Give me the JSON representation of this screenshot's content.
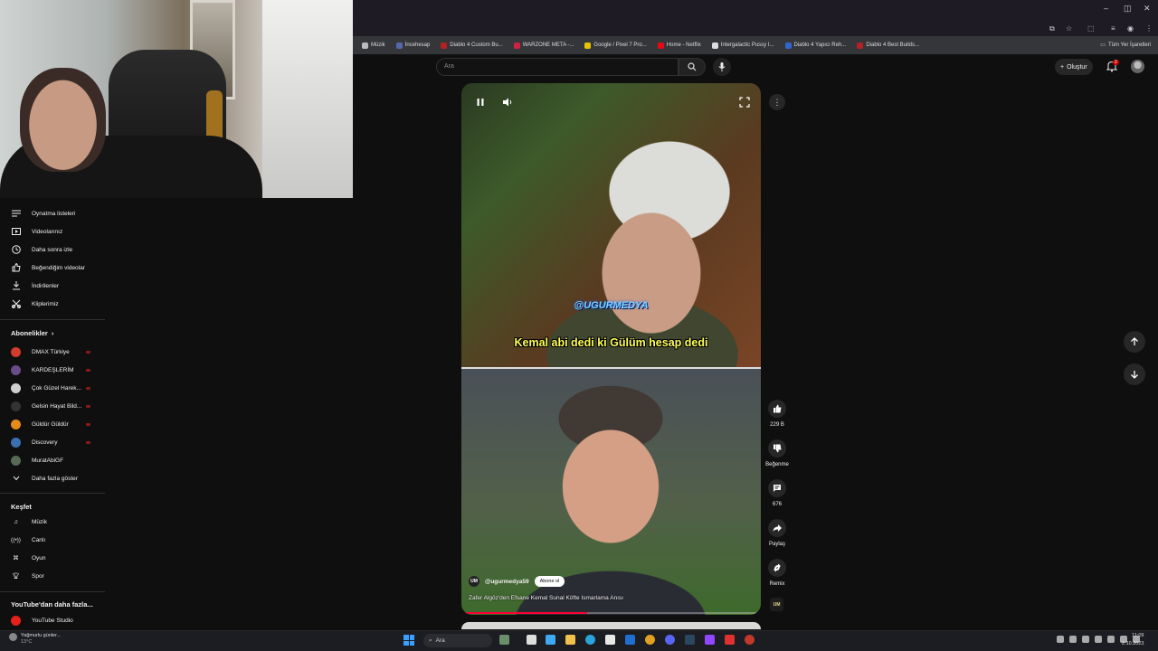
{
  "browser": {
    "bookmarks": [
      {
        "label": "Müzik",
        "color": "#bbbbbb"
      },
      {
        "label": "İncehesap",
        "color": "#5566aa"
      },
      {
        "label": "Diablo 4 Custom Bu...",
        "color": "#b22222"
      },
      {
        "label": "WARZONE META -...",
        "color": "#cc2244"
      },
      {
        "label": "Google / Pixel 7 Pro...",
        "color": "#e6c200"
      },
      {
        "label": "Home - Netflix",
        "color": "#e50914"
      },
      {
        "label": "Intergalactic Pussy I...",
        "color": "#dddddd"
      },
      {
        "label": "Diablo 4 Yapıcı Reh...",
        "color": "#3366cc"
      },
      {
        "label": "Diablo 4 Best Builds...",
        "color": "#b22222"
      }
    ],
    "other_bookmarks": "Tüm Yer İşaretleri"
  },
  "youtube": {
    "search_placeholder": "Ara",
    "create_label": "Oluştur",
    "notification_count": "2"
  },
  "sidebar": {
    "library_items": [
      {
        "label": "Oynatma listeleri",
        "icon": "playlist-icon"
      },
      {
        "label": "Videolarınız",
        "icon": "your-videos-icon"
      },
      {
        "label": "Daha sonra izle",
        "icon": "watch-later-icon"
      },
      {
        "label": "Beğendiğim videolar",
        "icon": "like-icon"
      },
      {
        "label": "İndirilenler",
        "icon": "download-icon"
      },
      {
        "label": "Kliplerimiz",
        "icon": "clips-icon"
      }
    ],
    "subscriptions_header": "Abonelikler",
    "subscriptions": [
      {
        "label": "DMAX Türkiye",
        "color": "#d33b2c",
        "live": true
      },
      {
        "label": "KARDEŞLERİM",
        "color": "#6a4c8a",
        "live": true
      },
      {
        "label": "Çok Güzel Harek...",
        "color": "#d0d0d0",
        "live": true
      },
      {
        "label": "Gelsin Hayat Bild...",
        "color": "#333333",
        "live": true
      },
      {
        "label": "Güldür Güldür",
        "color": "#e88a1a",
        "live": true
      },
      {
        "label": "Discovery",
        "color": "#3a6fb0",
        "live": true
      },
      {
        "label": "MuratAbiGF",
        "color": "#556b55",
        "live": false
      }
    ],
    "show_more": "Daha fazla göster",
    "explore_header": "Keşfet",
    "explore_items": [
      {
        "label": "Müzik",
        "icon": "music-icon"
      },
      {
        "label": "Canlı",
        "icon": "live-icon"
      },
      {
        "label": "Oyun",
        "icon": "gaming-icon"
      },
      {
        "label": "Spor",
        "icon": "trophy-icon"
      }
    ],
    "more_header": "YouTube'dan daha fazla...",
    "studio": "YouTube Studio"
  },
  "short": {
    "watermark": "@UGURMEDYA",
    "caption": "Kemal abi dedi ki Gülüm hesap dedi",
    "channel": "@ugurmedya59",
    "channel_logo": "UM",
    "subscribe": "Abone ol",
    "title": "Zafer Algöz'den Efsane Kemal Sunal Köfte Ismarlama Anısı",
    "progress": 0.42
  },
  "actions": {
    "likes": "229 B",
    "dislike": "Beğenme",
    "comments": "676",
    "share": "Paylaş",
    "remix": "Remix"
  },
  "taskbar": {
    "weather_title": "Yağmurlu günler...",
    "weather_temp": "13°C",
    "search": "Ara",
    "time": "11:09",
    "date": "2.10.2023"
  }
}
